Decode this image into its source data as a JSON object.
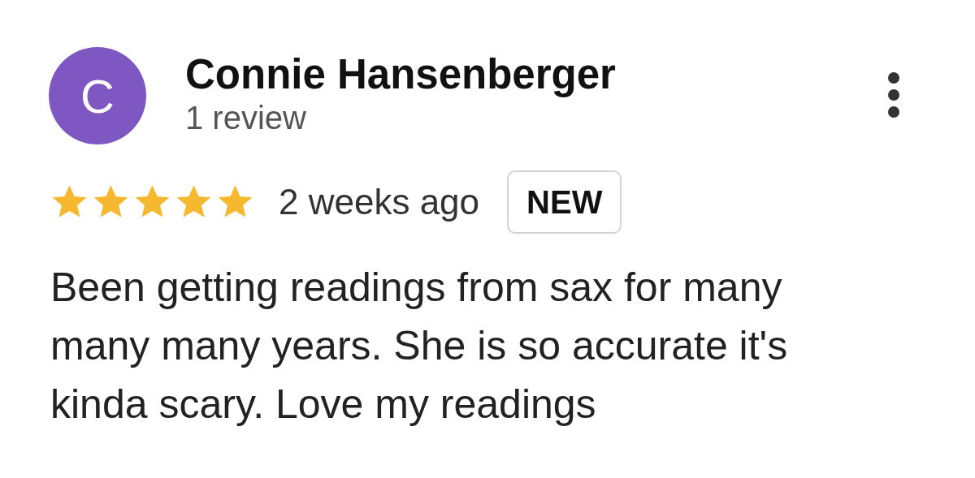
{
  "reviewer": {
    "initial": "C",
    "name": "Connie Hansenberger",
    "review_count": "1 review"
  },
  "rating": {
    "stars": 5
  },
  "time": "2 weeks ago",
  "badge": "NEW",
  "text": "Been getting readings from sax for many many many years. She is so accurate it's kinda scary. Love my readings"
}
